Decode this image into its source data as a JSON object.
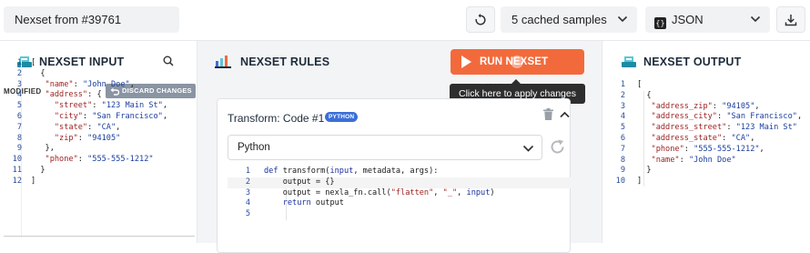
{
  "topbar": {
    "nexset_title": "Nexset from #39761",
    "samples_select": "5 cached samples",
    "format_select": "JSON",
    "format_icon_glyph": "{}"
  },
  "input_panel": {
    "title": "NEXSET INPUT",
    "status": "MODIFIED",
    "discard_label": "DISCARD CHANGES",
    "line_numbers": [
      "1",
      "2",
      "3",
      "4",
      "5",
      "6",
      "7",
      "8",
      "9",
      "10",
      "11",
      "12"
    ]
  },
  "rules_panel": {
    "title": "NEXSET RULES",
    "run_label": "RUN NEXSET RULES",
    "tooltip": "Click here to apply changes",
    "card_title": "Transform: Code #1",
    "card_badge": "PYTHON",
    "language": "Python",
    "line_numbers": [
      "1",
      "2",
      "3",
      "4",
      "5"
    ]
  },
  "output_panel": {
    "title": "NEXSET OUTPUT",
    "line_numbers": [
      "1",
      "2",
      "3",
      "4",
      "5",
      "6",
      "7",
      "8",
      "9",
      "10"
    ]
  },
  "colors": {
    "accent_orange": "#f26a3c",
    "badge_blue": "#3b6fd8",
    "json_key": "#9c1d1d",
    "json_string": "#1a3e9e"
  }
}
